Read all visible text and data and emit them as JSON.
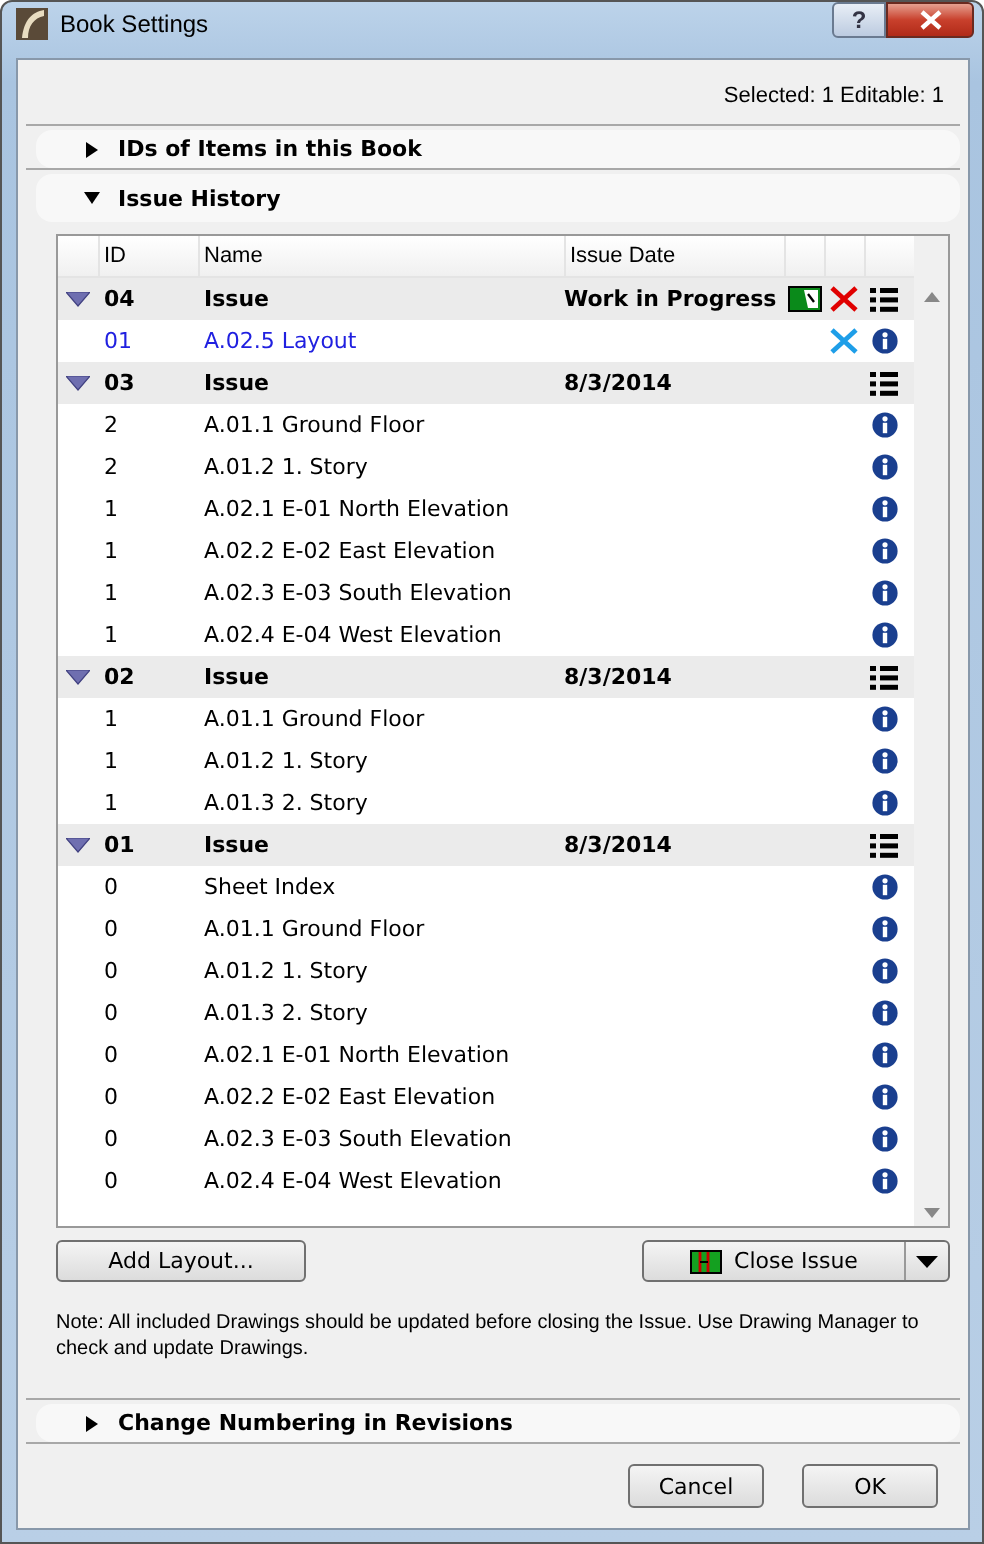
{
  "window": {
    "title": "Book Settings",
    "help": "?"
  },
  "status": "Selected: 1 Editable: 1",
  "sections_top": [
    {
      "title": "IDs of Items in this Book",
      "expanded": false
    },
    {
      "title": "Issue History",
      "expanded": true
    }
  ],
  "table": {
    "columns": [
      "ID",
      "Name",
      "Issue Date"
    ],
    "issues": [
      {
        "id": "04",
        "name": "Issue",
        "date": "Work in Progress",
        "expanded": true,
        "open": true,
        "items": [
          {
            "id": "01",
            "name": "A.02.5 Layout",
            "new": true
          }
        ]
      },
      {
        "id": "03",
        "name": "Issue",
        "date": "8/3/2014",
        "expanded": true,
        "open": false,
        "items": [
          {
            "id": "2",
            "name": "A.01.1 Ground Floor",
            "new": false
          },
          {
            "id": "2",
            "name": "A.01.2 1. Story",
            "new": false
          },
          {
            "id": "1",
            "name": "A.02.1 E-01 North Elevation",
            "new": false
          },
          {
            "id": "1",
            "name": "A.02.2 E-02 East Elevation",
            "new": false
          },
          {
            "id": "1",
            "name": "A.02.3 E-03 South Elevation",
            "new": false
          },
          {
            "id": "1",
            "name": "A.02.4 E-04 West Elevation",
            "new": false
          }
        ]
      },
      {
        "id": "02",
        "name": "Issue",
        "date": "8/3/2014",
        "expanded": true,
        "open": false,
        "items": [
          {
            "id": "1",
            "name": "A.01.1 Ground Floor",
            "new": false
          },
          {
            "id": "1",
            "name": "A.01.2 1. Story",
            "new": false
          },
          {
            "id": "1",
            "name": "A.01.3 2. Story",
            "new": false
          }
        ]
      },
      {
        "id": "01",
        "name": "Issue",
        "date": "8/3/2014",
        "expanded": true,
        "open": false,
        "items": [
          {
            "id": "0",
            "name": "Sheet Index",
            "new": false
          },
          {
            "id": "0",
            "name": "A.01.1 Ground Floor",
            "new": false
          },
          {
            "id": "0",
            "name": "A.01.2 1. Story",
            "new": false
          },
          {
            "id": "0",
            "name": "A.01.3 2. Story",
            "new": false
          },
          {
            "id": "0",
            "name": "A.02.1 E-01 North Elevation",
            "new": false
          },
          {
            "id": "0",
            "name": "A.02.2 E-02 East Elevation",
            "new": false
          },
          {
            "id": "0",
            "name": "A.02.3 E-03 South Elevation",
            "new": false
          },
          {
            "id": "0",
            "name": "A.02.4 E-04 West Elevation",
            "new": false
          }
        ]
      }
    ]
  },
  "add_button": "Add Layout...",
  "close_button": "Close Issue",
  "note": "Note: All included Drawings should be updated before closing the Issue. Use Drawing Manager to check and update Drawings.",
  "sections_bottom": [
    {
      "title": "Change Numbering in Revisions",
      "expanded": false
    }
  ],
  "buttons": [
    "Cancel",
    "OK"
  ]
}
